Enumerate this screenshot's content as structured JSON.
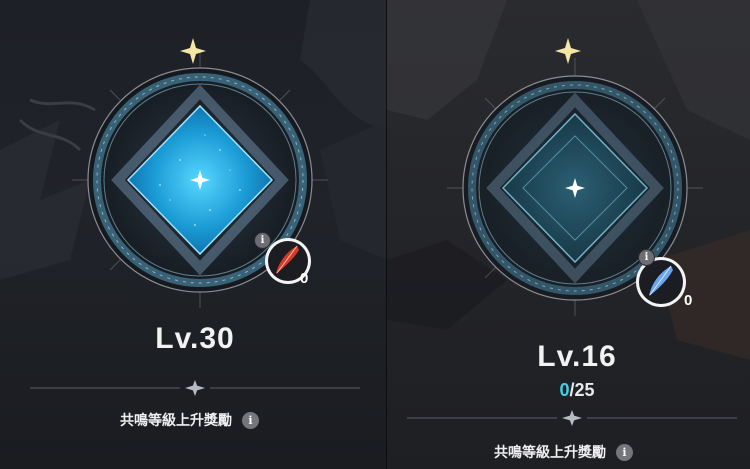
{
  "left_panel": {
    "level": "Lv.30",
    "reward_label": "共鳴等級上升獎勵",
    "item_count": "0",
    "info_glyph": "i",
    "emblem_state": "filled",
    "item_icon": "red-feather-icon",
    "accent": "#2aa8e0"
  },
  "right_panel": {
    "level": "Lv.16",
    "progress_current": "0",
    "progress_total": "/25",
    "reward_label": "共鳴等級上升獎勵",
    "item_count": "0",
    "info_glyph": "i",
    "emblem_state": "empty",
    "item_icon": "blue-feather-icon",
    "accent": "#3fd0ea"
  }
}
